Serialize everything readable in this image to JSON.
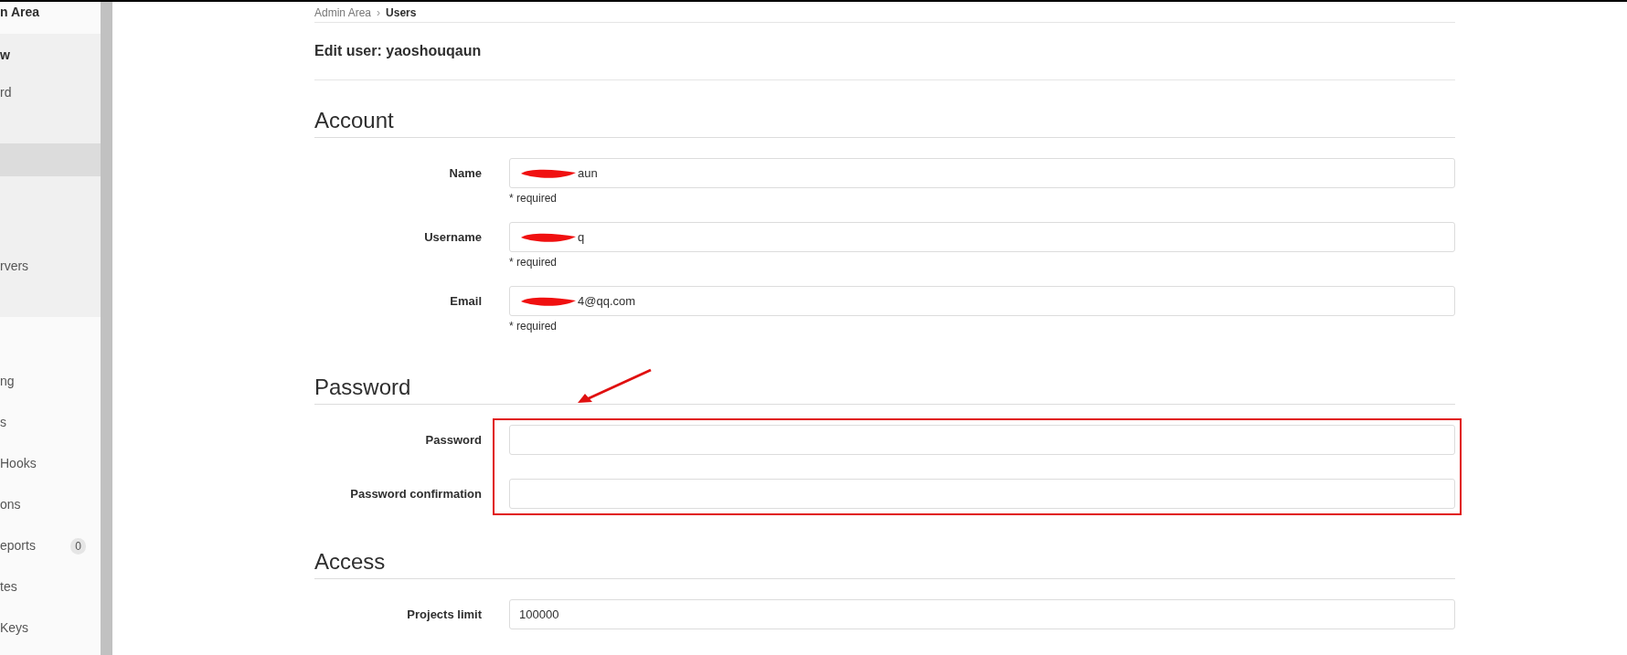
{
  "sidebar": {
    "title": "n Area",
    "group": {
      "label": "w",
      "expanded": true,
      "children": [
        {
          "label": "rd",
          "selected": false
        },
        {
          "selected": true
        },
        {
          "label": "rvers",
          "selected": false
        }
      ]
    },
    "items": [
      {
        "label": "ng",
        "selected": false
      },
      {
        "label": "s",
        "selected": false
      },
      {
        "label": "Hooks",
        "selected": false
      },
      {
        "label": "ons",
        "selected": false
      },
      {
        "label": "eports",
        "selected": false,
        "badge": "0"
      },
      {
        "label": "tes",
        "selected": false
      },
      {
        "label": "Keys",
        "selected": false
      }
    ]
  },
  "breadcrumb": {
    "items": [
      "Admin Area",
      "Users"
    ],
    "separator": "›"
  },
  "page_title": "Edit user: yaoshouqaun",
  "sections": [
    {
      "title": "Account",
      "highlighted": false,
      "fields": [
        {
          "label": "Name",
          "value": "aun",
          "redacted": true,
          "hint": "* required"
        },
        {
          "label": "Username",
          "value": "q",
          "redacted": true,
          "hint": "* required"
        },
        {
          "label": "Email",
          "value": "4@qq.com",
          "redacted": true,
          "hint": "* required"
        }
      ]
    },
    {
      "title": "Password",
      "highlighted": true,
      "fields": [
        {
          "label": "Password",
          "redacted": false
        },
        {
          "label": "Password confirmation",
          "redacted": false
        }
      ]
    },
    {
      "title": "Access",
      "highlighted": false,
      "fields": [
        {
          "label": "Projects limit",
          "value": "100000",
          "redacted": false
        }
      ]
    }
  ]
}
